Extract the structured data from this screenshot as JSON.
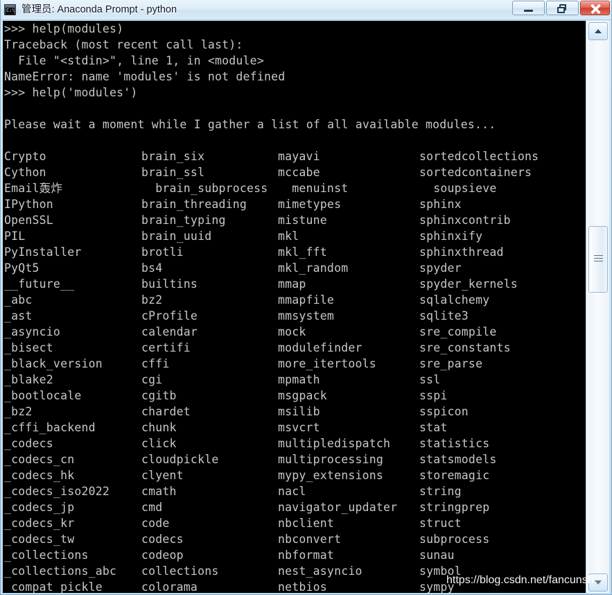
{
  "window": {
    "title": "管理员: Anaconda Prompt - python",
    "icon": "console-icon",
    "prompt_glyph": "C:\\",
    "buttons": {
      "minimize": "Minimize",
      "maximize": "Restore",
      "close": "Close"
    }
  },
  "console": {
    "header_lines": [
      ">>> help(modules)",
      "Traceback (most recent call last):",
      "  File \"<stdin>\", line 1, in <module>",
      "NameError: name 'modules' is not defined",
      ">>> help('modules')",
      "",
      "Please wait a moment while I gather a list of all available modules..."
    ],
    "columns": [
      [
        "Crypto",
        "Cython",
        "Email轰炸",
        "IPython",
        "OpenSSL",
        "PIL",
        "PyInstaller",
        "PyQt5",
        "__future__",
        "_abc",
        "_ast",
        "_asyncio",
        "_bisect",
        "_black_version",
        "_blake2",
        "_bootlocale",
        "_bz2",
        "_cffi_backend",
        "_codecs",
        "_codecs_cn",
        "_codecs_hk",
        "_codecs_iso2022",
        "_codecs_jp",
        "_codecs_kr",
        "_codecs_tw",
        "_collections",
        "_collections_abc",
        "_compat_pickle"
      ],
      [
        "brain_six",
        "brain_ssl",
        "  brain_subprocess",
        "brain_threading",
        "brain_typing",
        "brain_uuid",
        "brotli",
        "bs4",
        "builtins",
        "bz2",
        "cProfile",
        "calendar",
        "certifi",
        "cffi",
        "cgi",
        "cgitb",
        "chardet",
        "chunk",
        "click",
        "cloudpickle",
        "clyent",
        "cmath",
        "cmd",
        "code",
        "codecs",
        "codeop",
        "collections",
        "colorama"
      ],
      [
        "mayavi",
        "mccabe",
        "  menuinst",
        "mimetypes",
        "mistune",
        "mkl",
        "mkl_fft",
        "mkl_random",
        "mmap",
        "mmapfile",
        "mmsystem",
        "mock",
        "modulefinder",
        "more_itertools",
        "mpmath",
        "msgpack",
        "msilib",
        "msvcrt",
        "multipledispatch",
        "multiprocessing",
        "mypy_extensions",
        "nacl",
        "navigator_updater",
        "nbclient",
        "nbconvert",
        "nbformat",
        "nest_asyncio",
        "netbios"
      ],
      [
        "sortedcollections",
        "sortedcontainers",
        "  soupsieve",
        "sphinx",
        "sphinxcontrib",
        "sphinxify",
        "sphinxthread",
        "spyder",
        "spyder_kernels",
        "sqlalchemy",
        "sqlite3",
        "sre_compile",
        "sre_constants",
        "sre_parse",
        "ssl",
        "sspi",
        "sspicon",
        "stat",
        "statistics",
        "statsmodels",
        "storemagic",
        "string",
        "stringprep",
        "struct",
        "subprocess",
        "sunau",
        "symbol",
        "sympy"
      ]
    ]
  },
  "scrollbar": {
    "up_arrow": "scroll-up",
    "down_arrow": "scroll-down",
    "thumb": "scroll-thumb"
  },
  "watermark": {
    "text": "https://blog.csdn.net/fancunsh"
  },
  "colors": {
    "console_bg": "#000000",
    "console_fg": "#c8c8c8",
    "titlebar": "#dcecf8",
    "close_button": "#cf3e2c",
    "frame_border": "#7fa9c9"
  }
}
